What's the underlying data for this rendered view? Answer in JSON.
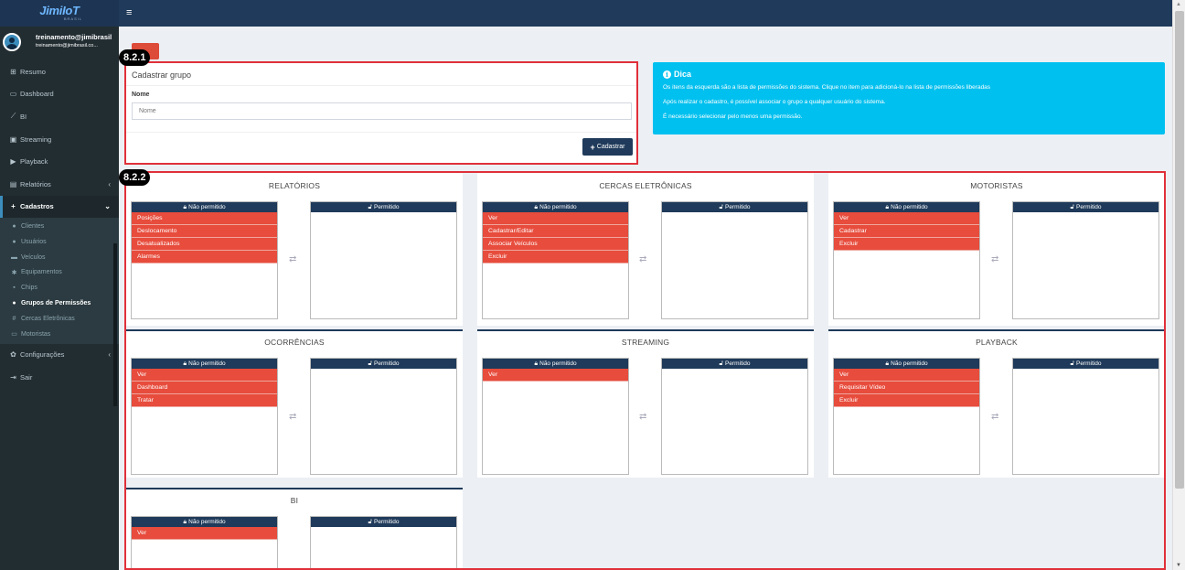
{
  "header": {
    "logo_main": "JimiIoT",
    "logo_sub": "BRASIL",
    "menu_icon": "hamburger-icon"
  },
  "user": {
    "name": "treinamento@jimibrasil",
    "email": "treinamento@jimibrasil.co..."
  },
  "sidebar": {
    "items": [
      {
        "label": "Resumo",
        "icon": "sitemap-icon"
      },
      {
        "label": "Dashboard",
        "icon": "monitor-icon"
      },
      {
        "label": "BI",
        "icon": "chart-icon"
      },
      {
        "label": "Streaming",
        "icon": "film-icon"
      },
      {
        "label": "Playback",
        "icon": "play-icon"
      },
      {
        "label": "Relatórios",
        "icon": "file-icon"
      },
      {
        "label": "Cadastros",
        "icon": "plus-icon"
      }
    ],
    "submenu": [
      {
        "label": "Clientes",
        "icon": "user-icon"
      },
      {
        "label": "Usuários",
        "icon": "users-icon"
      },
      {
        "label": "Veículos",
        "icon": "car-icon"
      },
      {
        "label": "Equipamentos",
        "icon": "cogs-icon"
      },
      {
        "label": "Chips",
        "icon": "sim-icon"
      },
      {
        "label": "Grupos de Permissões",
        "icon": "group-icon"
      },
      {
        "label": "Cercas Eletrônicas",
        "icon": "fence-icon"
      },
      {
        "label": "Motoristas",
        "icon": "id-card-icon"
      }
    ],
    "after": [
      {
        "label": "Configurações",
        "icon": "gear-icon"
      },
      {
        "label": "Sair",
        "icon": "sign-out-icon"
      }
    ]
  },
  "badges": {
    "form": "8.2.1",
    "perms": "8.2.2"
  },
  "form": {
    "title": "Cadastrar grupo",
    "label": "Nome",
    "placeholder": "Nome",
    "button": "Cadastrar"
  },
  "tip": {
    "title": "Dica",
    "lines": [
      "Os itens da esquerda são a lista de permissões do sistema. Clique no item para adicioná-lo na lista de permissões liberadas",
      "Após realizar o cadastro, é possível associar o grupo a qualquer usuário do sistema.",
      "É necessário selecionar pelo menos uma permissão."
    ]
  },
  "lists": {
    "denied": "Não permitido",
    "allowed": "Permitido"
  },
  "panels": [
    {
      "title": "RELATÓRIOS",
      "denied": [
        "Posições",
        "Deslocamento",
        "Desatualizados",
        "Alarmes"
      ],
      "allowed": []
    },
    {
      "title": "CERCAS ELETRÔNICAS",
      "denied": [
        "Ver",
        "Cadastrar/Editar",
        "Associar Veículos",
        "Excluir"
      ],
      "allowed": []
    },
    {
      "title": "MOTORISTAS",
      "denied": [
        "Ver",
        "Cadastrar",
        "Excluir"
      ],
      "allowed": []
    },
    {
      "title": "OCORRÊNCIAS",
      "denied": [
        "Ver",
        "Dashboard",
        "Tratar"
      ],
      "allowed": []
    },
    {
      "title": "STREAMING",
      "denied": [
        "Ver"
      ],
      "allowed": []
    },
    {
      "title": "PLAYBACK",
      "denied": [
        "Ver",
        "Requisitar Vídeo",
        "Excluir"
      ],
      "allowed": []
    },
    {
      "title": "BI",
      "denied": [
        "Ver"
      ],
      "allowed": []
    }
  ]
}
